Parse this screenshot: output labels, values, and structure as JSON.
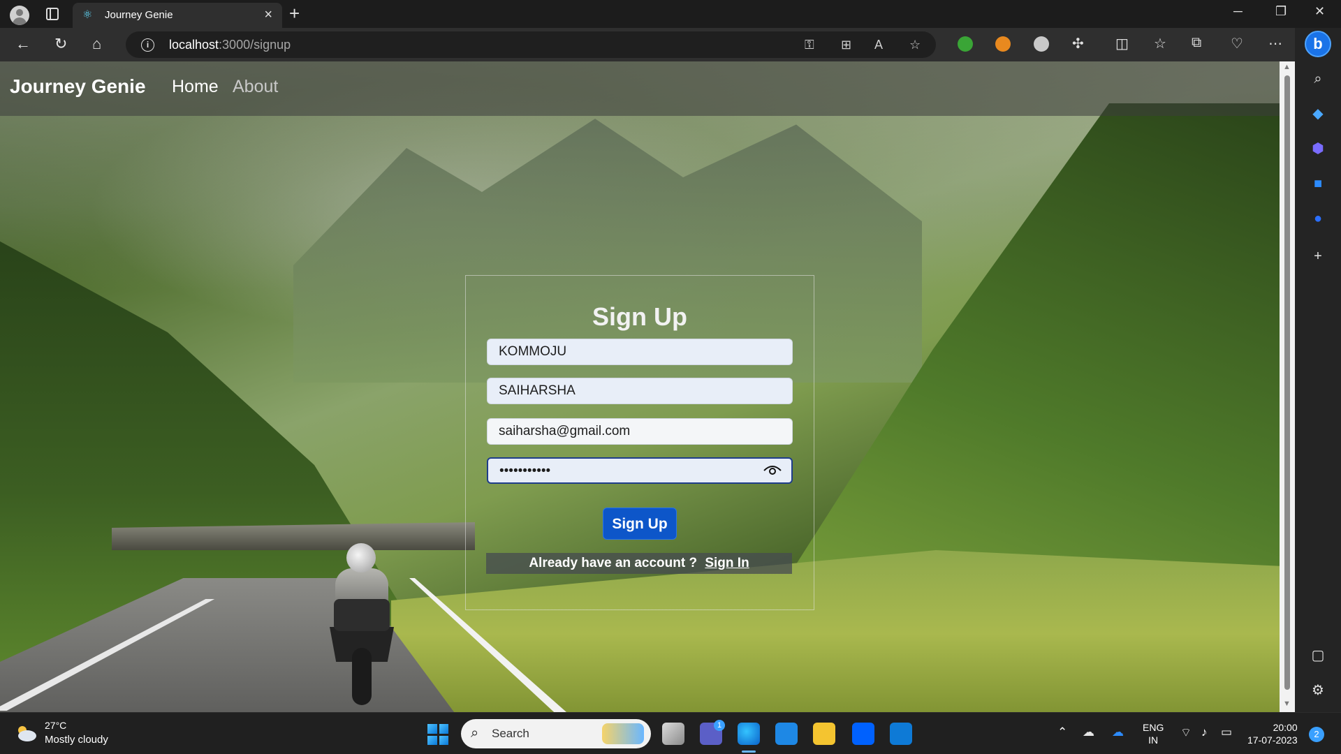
{
  "browser": {
    "tab_title": "Journey Genie",
    "url_host": "localhost",
    "url_path": ":3000/signup"
  },
  "app": {
    "brand": "Journey Genie",
    "nav": [
      {
        "label": "Home",
        "color": "#ffffff"
      },
      {
        "label": "About",
        "color": "#c9c9c9"
      }
    ]
  },
  "signup": {
    "title": "Sign Up",
    "fields": {
      "first_name": "KOMMOJU",
      "last_name": "SAIHARSHA",
      "email": "saiharsha@gmail.com",
      "password_masked": "•••••••••••"
    },
    "submit_label": "Sign Up",
    "signin_prompt": "Already have an account ?",
    "signin_link": "Sign In"
  },
  "taskbar": {
    "weather_temp": "27°C",
    "weather_desc": "Mostly cloudy",
    "search_label": "Search",
    "teams_badge": "1",
    "lang_primary": "ENG",
    "lang_secondary": "IN",
    "time": "20:00",
    "date": "17-07-2023",
    "notification_count": "2"
  },
  "colors": {
    "primary_button": "#0d56c9",
    "accent_blue": "#1a73e8"
  }
}
